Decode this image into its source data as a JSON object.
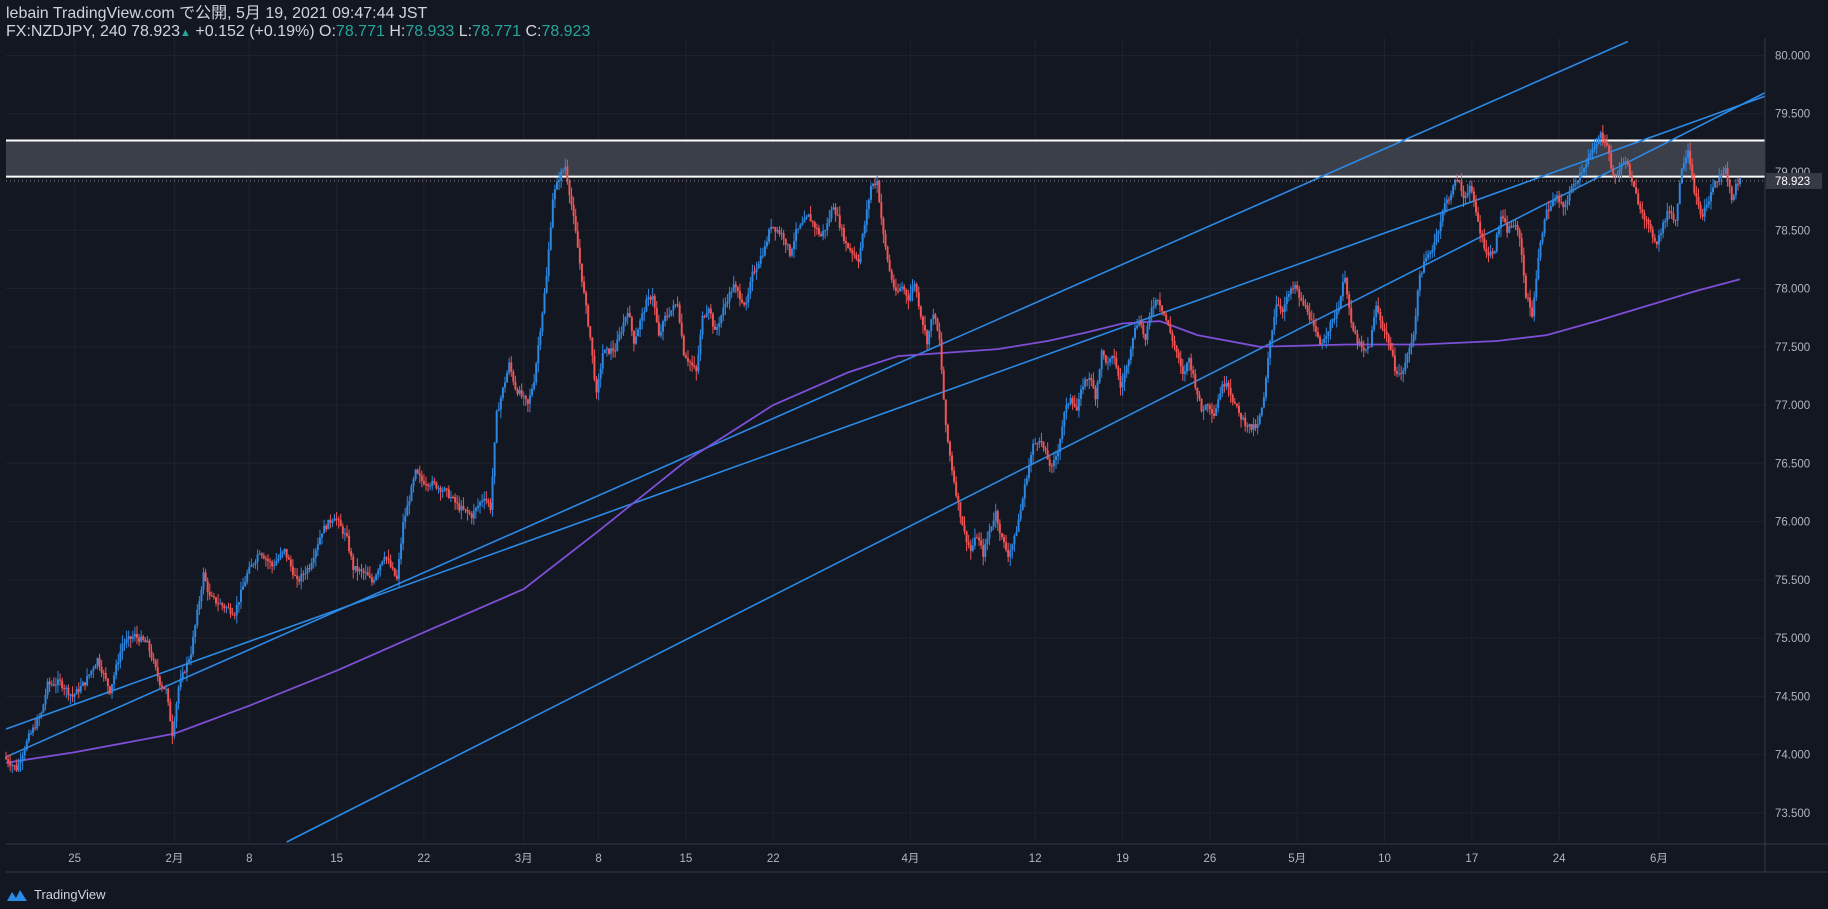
{
  "header": {
    "publisher": "lebain TradingView.com で公開, 5月 19, 2021 09:47:44 JST",
    "symbol": "FX:NZDJPY, 240",
    "last": "78.923",
    "change": "+0.152 (+0.19%)",
    "o_label": "O:",
    "o_value": "78.771",
    "h_label": "H:",
    "h_value": "78.933",
    "l_label": "L:",
    "l_value": "78.771",
    "c_label": "C:",
    "c_value": "78.923"
  },
  "footer": {
    "brand": "TradingView",
    "icon": "tradingview-logo-icon"
  },
  "colors": {
    "background": "#131722",
    "up": "#2e86de",
    "down": "#f05454",
    "trendline": "#2b8ae6",
    "moving_average": "#7e4fd6",
    "zone_fill": "#434651",
    "zone_line": "#ffffff",
    "grid": "#1e222d",
    "axis_text": "#b2b5be"
  },
  "chart_data": {
    "type": "candlestick",
    "symbol": "FX:NZDJPY",
    "timeframe": "240",
    "y_range": [
      73.25,
      80.15
    ],
    "y_ticks": [
      "80.000",
      "79.500",
      "79.000",
      "78.500",
      "78.000",
      "77.500",
      "77.000",
      "76.500",
      "76.000",
      "75.500",
      "75.000",
      "74.500",
      "74.000",
      "73.500"
    ],
    "x_ticks": [
      "25",
      "2月",
      "8",
      "15",
      "22",
      "3月",
      "8",
      "15",
      "22",
      "4月",
      "12",
      "19",
      "26",
      "5月",
      "10",
      "17",
      "24",
      "6月"
    ],
    "x_tick_days": [
      0,
      8,
      14,
      21,
      28,
      36,
      42,
      49,
      56,
      67,
      77,
      84,
      91,
      98,
      105,
      112,
      119,
      127
    ],
    "x_range_days": [
      -5.5,
      135.5
    ],
    "last_price_label": "78.923",
    "last_price": 78.923,
    "price_path": [
      [
        -5.5,
        73.98
      ],
      [
        -4.5,
        73.88
      ],
      [
        -3.5,
        74.15
      ],
      [
        -2.5,
        74.35
      ],
      [
        -2,
        74.6
      ],
      [
        -1,
        74.62
      ],
      [
        0,
        74.5
      ],
      [
        1,
        74.62
      ],
      [
        2,
        74.82
      ],
      [
        3,
        74.55
      ],
      [
        4,
        74.95
      ],
      [
        5,
        75.02
      ],
      [
        6,
        74.95
      ],
      [
        7,
        74.62
      ],
      [
        7.5,
        74.55
      ],
      [
        8,
        74.18
      ],
      [
        8.5,
        74.58
      ],
      [
        9.5,
        74.88
      ],
      [
        10.5,
        75.55
      ],
      [
        11,
        75.35
      ],
      [
        12,
        75.28
      ],
      [
        13,
        75.22
      ],
      [
        14,
        75.55
      ],
      [
        15,
        75.75
      ],
      [
        16,
        75.62
      ],
      [
        17,
        75.75
      ],
      [
        18,
        75.48
      ],
      [
        19,
        75.62
      ],
      [
        20,
        75.92
      ],
      [
        21,
        76.05
      ],
      [
        22,
        75.85
      ],
      [
        22.5,
        75.6
      ],
      [
        23.5,
        75.55
      ],
      [
        24,
        75.48
      ],
      [
        25,
        75.72
      ],
      [
        26,
        75.5
      ],
      [
        26.5,
        75.98
      ],
      [
        27.5,
        76.42
      ],
      [
        28,
        76.35
      ],
      [
        29,
        76.32
      ],
      [
        30,
        76.25
      ],
      [
        31,
        76.12
      ],
      [
        32,
        76.05
      ],
      [
        33,
        76.22
      ],
      [
        33.5,
        76.12
      ],
      [
        34,
        76.92
      ],
      [
        35,
        77.35
      ],
      [
        35.5,
        77.15
      ],
      [
        36.5,
        77.0
      ],
      [
        37,
        77.22
      ],
      [
        38,
        78.1
      ],
      [
        38.5,
        78.78
      ],
      [
        39,
        78.95
      ],
      [
        39.5,
        79.05
      ],
      [
        40,
        78.72
      ],
      [
        40.5,
        78.35
      ],
      [
        41,
        77.95
      ],
      [
        41.5,
        77.58
      ],
      [
        42,
        77.08
      ],
      [
        42.5,
        77.45
      ],
      [
        43.5,
        77.48
      ],
      [
        44.5,
        77.82
      ],
      [
        45,
        77.55
      ],
      [
        46,
        77.88
      ],
      [
        46.5,
        77.95
      ],
      [
        47,
        77.58
      ],
      [
        47.5,
        77.75
      ],
      [
        48.5,
        77.88
      ],
      [
        49,
        77.45
      ],
      [
        50,
        77.28
      ],
      [
        50.5,
        77.75
      ],
      [
        51,
        77.85
      ],
      [
        51.5,
        77.62
      ],
      [
        52.5,
        77.92
      ],
      [
        53,
        78.02
      ],
      [
        54,
        77.85
      ],
      [
        54.5,
        78.12
      ],
      [
        55.5,
        78.35
      ],
      [
        56,
        78.55
      ],
      [
        57,
        78.45
      ],
      [
        57.5,
        78.3
      ],
      [
        58,
        78.48
      ],
      [
        59,
        78.62
      ],
      [
        60,
        78.45
      ],
      [
        60.5,
        78.55
      ],
      [
        61,
        78.72
      ],
      [
        61.5,
        78.55
      ],
      [
        62,
        78.38
      ],
      [
        63,
        78.25
      ],
      [
        63.5,
        78.55
      ],
      [
        64,
        78.88
      ],
      [
        64.5,
        78.92
      ],
      [
        65,
        78.45
      ],
      [
        65.5,
        78.15
      ],
      [
        66,
        77.95
      ],
      [
        66.5,
        78.02
      ],
      [
        67,
        77.92
      ],
      [
        67.5,
        78.05
      ],
      [
        68,
        77.78
      ],
      [
        68.5,
        77.55
      ],
      [
        69,
        77.8
      ],
      [
        69.5,
        77.55
      ],
      [
        70,
        76.8
      ],
      [
        70.5,
        76.45
      ],
      [
        71,
        76.15
      ],
      [
        71.5,
        75.9
      ],
      [
        72,
        75.75
      ],
      [
        72.5,
        75.88
      ],
      [
        73,
        75.72
      ],
      [
        73.5,
        75.92
      ],
      [
        74,
        76.08
      ],
      [
        74.5,
        75.85
      ],
      [
        75,
        75.72
      ],
      [
        75.5,
        75.85
      ],
      [
        76,
        76.1
      ],
      [
        76.5,
        76.4
      ],
      [
        77,
        76.65
      ],
      [
        77.5,
        76.72
      ],
      [
        78,
        76.58
      ],
      [
        78.5,
        76.45
      ],
      [
        79,
        76.62
      ],
      [
        79.5,
        76.92
      ],
      [
        80,
        77.08
      ],
      [
        80.5,
        76.95
      ],
      [
        81,
        77.18
      ],
      [
        81.5,
        77.25
      ],
      [
        82,
        77.08
      ],
      [
        82.5,
        77.45
      ],
      [
        83,
        77.35
      ],
      [
        83.5,
        77.42
      ],
      [
        84,
        77.15
      ],
      [
        84.5,
        77.32
      ],
      [
        85,
        77.6
      ],
      [
        85.5,
        77.75
      ],
      [
        86,
        77.55
      ],
      [
        86.5,
        77.85
      ],
      [
        87,
        77.92
      ],
      [
        87.5,
        77.78
      ],
      [
        88,
        77.62
      ],
      [
        88.5,
        77.45
      ],
      [
        89,
        77.25
      ],
      [
        89.5,
        77.4
      ],
      [
        90,
        77.18
      ],
      [
        90.5,
        76.95
      ],
      [
        91,
        77.02
      ],
      [
        91.5,
        76.92
      ],
      [
        92,
        77.12
      ],
      [
        92.5,
        77.22
      ],
      [
        93,
        77.05
      ],
      [
        93.5,
        76.92
      ],
      [
        94,
        76.85
      ],
      [
        94.5,
        76.8
      ],
      [
        95,
        76.82
      ],
      [
        95.5,
        77.05
      ],
      [
        96,
        77.55
      ],
      [
        96.5,
        77.88
      ],
      [
        97,
        77.82
      ],
      [
        97.5,
        77.95
      ],
      [
        98,
        78.02
      ],
      [
        98.5,
        77.88
      ],
      [
        99,
        77.82
      ],
      [
        99.5,
        77.65
      ],
      [
        100,
        77.52
      ],
      [
        100.5,
        77.62
      ],
      [
        101,
        77.72
      ],
      [
        101.5,
        77.85
      ],
      [
        102,
        78.12
      ],
      [
        102.5,
        77.68
      ],
      [
        103,
        77.55
      ],
      [
        103.5,
        77.45
      ],
      [
        104,
        77.52
      ],
      [
        104.5,
        77.85
      ],
      [
        105,
        77.68
      ],
      [
        105.5,
        77.55
      ],
      [
        106,
        77.32
      ],
      [
        106.5,
        77.25
      ],
      [
        107,
        77.42
      ],
      [
        107.5,
        77.62
      ],
      [
        108,
        78.12
      ],
      [
        108.5,
        78.25
      ],
      [
        109,
        78.35
      ],
      [
        109.5,
        78.52
      ],
      [
        110,
        78.72
      ],
      [
        110.5,
        78.82
      ],
      [
        111,
        78.95
      ],
      [
        111.5,
        78.78
      ],
      [
        112,
        78.88
      ],
      [
        112.5,
        78.65
      ],
      [
        113,
        78.42
      ],
      [
        113.5,
        78.28
      ],
      [
        114,
        78.35
      ],
      [
        114.5,
        78.62
      ],
      [
        115,
        78.5
      ],
      [
        115.5,
        78.55
      ],
      [
        116,
        78.45
      ],
      [
        116.5,
        77.95
      ],
      [
        117,
        77.78
      ],
      [
        117.5,
        78.25
      ],
      [
        118,
        78.62
      ],
      [
        118.5,
        78.72
      ],
      [
        119,
        78.78
      ],
      [
        119.5,
        78.68
      ],
      [
        120,
        78.82
      ],
      [
        120.5,
        78.92
      ],
      [
        121,
        79.02
      ],
      [
        121.5,
        79.12
      ],
      [
        122,
        79.2
      ],
      [
        122.5,
        79.32
      ],
      [
        123,
        79.25
      ],
      [
        123.5,
        78.95
      ],
      [
        124,
        79.02
      ],
      [
        124.5,
        79.12
      ],
      [
        125,
        78.9
      ],
      [
        125.5,
        78.75
      ],
      [
        126,
        78.62
      ],
      [
        126.5,
        78.48
      ],
      [
        127,
        78.4
      ],
      [
        127.5,
        78.55
      ],
      [
        128,
        78.68
      ],
      [
        128.5,
        78.58
      ],
      [
        129,
        79.05
      ],
      [
        129.5,
        79.2
      ],
      [
        130,
        78.85
      ],
      [
        130.5,
        78.62
      ],
      [
        131,
        78.7
      ],
      [
        131.5,
        78.88
      ],
      [
        132,
        78.95
      ],
      [
        132.5,
        79.02
      ],
      [
        133,
        78.78
      ],
      [
        133.5,
        78.923
      ]
    ],
    "moving_average": [
      [
        -5.5,
        73.93
      ],
      [
        0,
        74.02
      ],
      [
        8,
        74.18
      ],
      [
        14,
        74.42
      ],
      [
        21,
        74.72
      ],
      [
        28,
        75.05
      ],
      [
        36,
        75.42
      ],
      [
        42,
        75.92
      ],
      [
        49,
        76.52
      ],
      [
        56,
        77.0
      ],
      [
        62,
        77.28
      ],
      [
        66,
        77.42
      ],
      [
        70,
        77.45
      ],
      [
        74,
        77.48
      ],
      [
        78,
        77.55
      ],
      [
        81,
        77.62
      ],
      [
        84,
        77.7
      ],
      [
        87,
        77.72
      ],
      [
        90,
        77.6
      ],
      [
        95,
        77.5
      ],
      [
        102,
        77.52
      ],
      [
        108,
        77.52
      ],
      [
        114,
        77.55
      ],
      [
        118,
        77.6
      ],
      [
        122,
        77.72
      ],
      [
        126,
        77.85
      ],
      [
        130,
        77.98
      ],
      [
        133.5,
        78.08
      ]
    ],
    "trendlines": [
      {
        "role": "upper-channel",
        "points": [
          [
            -5.5,
            73.98
          ],
          [
            124.5,
            80.12
          ]
        ]
      },
      {
        "role": "lower-channel",
        "points": [
          [
            -5.5,
            74.22
          ],
          [
            135.5,
            79.65
          ]
        ]
      },
      {
        "role": "parallel-line",
        "points": [
          [
            17,
            73.25
          ],
          [
            135.5,
            79.68
          ]
        ]
      }
    ],
    "resistance_zone": {
      "top": 79.27,
      "bottom": 78.96
    }
  }
}
